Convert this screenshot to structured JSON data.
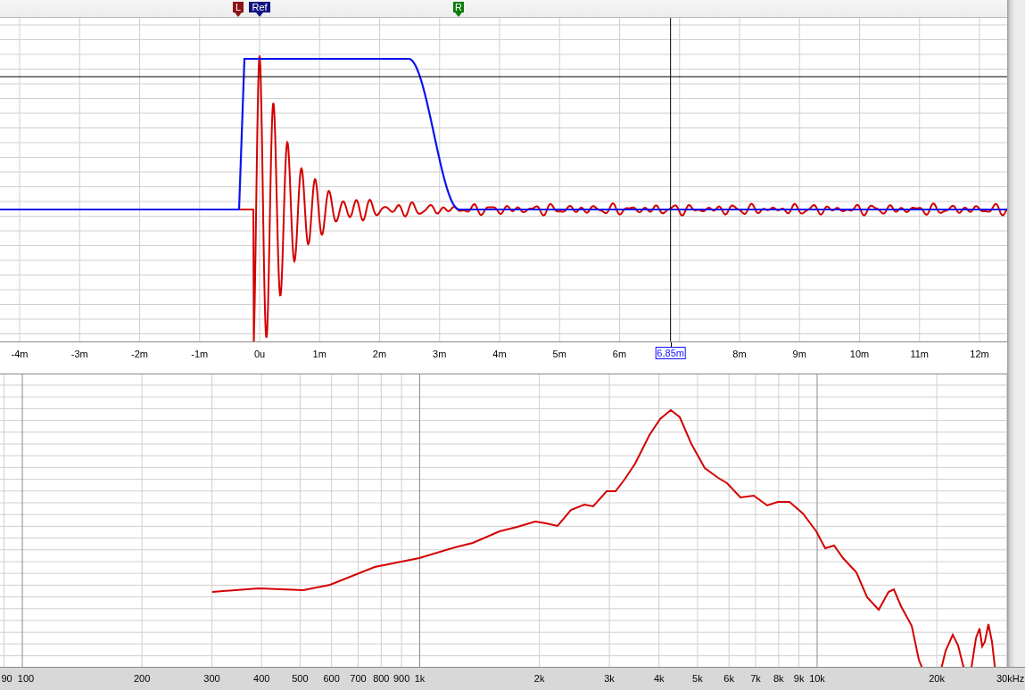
{
  "markers": [
    {
      "label": "L",
      "color": "#8b1414"
    },
    {
      "label": "Ref",
      "color": "#12127e"
    },
    {
      "label": "R",
      "color": "#0b7d0b"
    }
  ],
  "impulse_plot": {
    "x_axis_labels": [
      "-4m",
      "-3m",
      "-2m",
      "-1m",
      "0u",
      "1m",
      "2m",
      "3m",
      "4m",
      "5m",
      "6m",
      "8m",
      "9m",
      "10m",
      "11m",
      "12m"
    ],
    "cursor_readout": "6,85m"
  },
  "frequency_plot": {
    "x_axis_labels": [
      "90",
      "100",
      "200",
      "300",
      "400",
      "500",
      "600",
      "700",
      "800",
      "900",
      "1k",
      "2k",
      "3k",
      "4k",
      "5k",
      "6k",
      "7k",
      "8k",
      "9k",
      "10k",
      "20k",
      "30kHz"
    ]
  }
}
